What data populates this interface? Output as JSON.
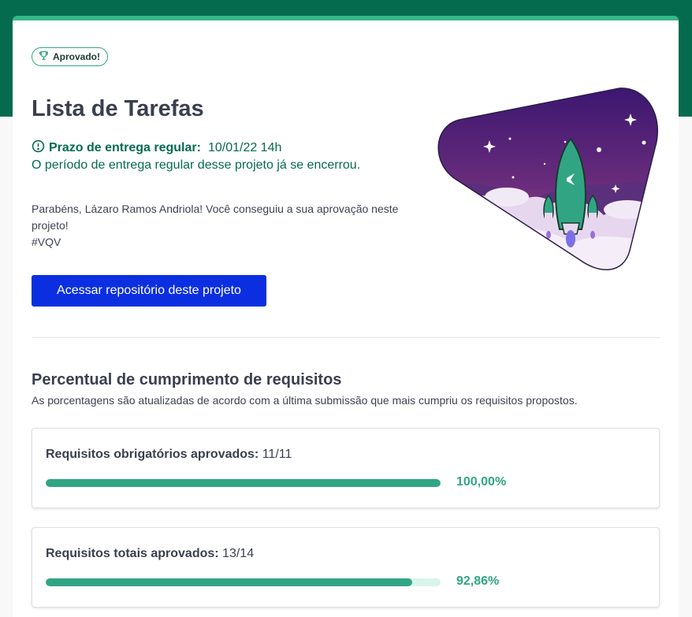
{
  "badge": {
    "label": "Aprovado!",
    "icon": "trophy-icon"
  },
  "project": {
    "title": "Lista de Tarefas",
    "deadline_label": "Prazo de entrega regular:",
    "deadline_value": "10/01/22 14h",
    "deadline_closed": "O período de entrega regular desse projeto já se encerrou.",
    "congrats_line1": "Parabéns, Lázaro Ramos Andriola! Você conseguiu a sua aprovação neste projeto!",
    "congrats_line2": "#VQV",
    "repo_button": "Acessar repositório deste projeto"
  },
  "requirements": {
    "title": "Percentual de cumprimento de requisitos",
    "subtitle": "As porcentagens são atualizadas de acordo com a última submissão que mais cumpriu os requisitos propostos.",
    "cards": [
      {
        "label": "Requisitos obrigatórios aprovados:",
        "count": "11/11",
        "percent_text": "100,00%",
        "fraction": 1.0
      },
      {
        "label": "Requisitos totais aprovados:",
        "count": "13/14",
        "percent_text": "92,86%",
        "fraction": 0.9286
      }
    ]
  },
  "colors": {
    "header_band": "#046b4e",
    "accent_green": "#31a583",
    "primary_button": "#0b2fe0",
    "deadline_text": "#046b4e"
  }
}
